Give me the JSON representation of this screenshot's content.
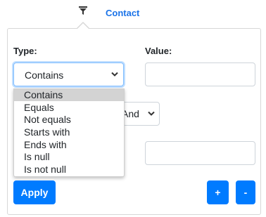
{
  "header": {
    "tab_label": "Contact",
    "filter_icon": "filter-icon"
  },
  "filter": {
    "type_label": "Type:",
    "value_label": "Value:",
    "type_select": {
      "selected": "Contains",
      "options": [
        "Contains",
        "Equals",
        "Not equals",
        "Starts with",
        "Ends with",
        "Is null",
        "Is not null"
      ],
      "highlighted": "Contains"
    },
    "operator_select": {
      "selected": "And"
    },
    "value1": "",
    "value2": ""
  },
  "actions": {
    "apply_label": "Apply",
    "add_label": "+",
    "remove_label": "-"
  },
  "colors": {
    "accent": "#007bff",
    "link": "#1a73e8",
    "highlight": "#d3d3d3"
  }
}
